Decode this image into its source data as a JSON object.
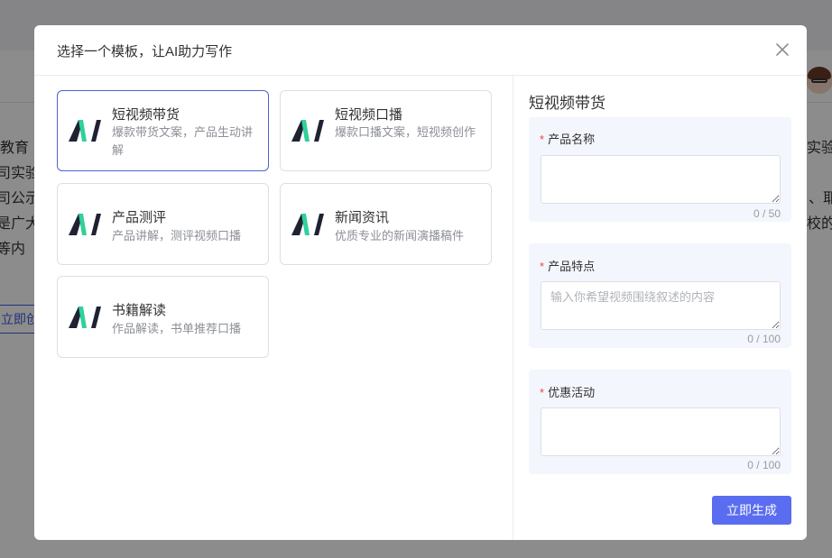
{
  "background": {
    "left_lines": [
      "教育",
      "司实验",
      "司公示",
      "是广大",
      "等内"
    ],
    "right_lines": [
      "实验",
      "、耶",
      "校的"
    ],
    "button_label": "立即创作"
  },
  "dialog": {
    "title": "选择一个模板，让AI助力写作",
    "templates": [
      {
        "name": "短视频带货",
        "desc": "爆款带货文案，产品生动讲解",
        "active": true
      },
      {
        "name": "短视频口播",
        "desc": "爆款口播文案，短视频创作",
        "active": false
      },
      {
        "name": "产品测评",
        "desc": "产品讲解，测评视频口播",
        "active": false
      },
      {
        "name": "新闻资讯",
        "desc": "优质专业的新闻演播稿件",
        "active": false
      },
      {
        "name": "书籍解读",
        "desc": "作品解读，书单推荐口播",
        "active": false
      }
    ],
    "form": {
      "title": "短视频带货",
      "fields": [
        {
          "label": "产品名称",
          "required_mark": "*",
          "value": "",
          "placeholder": "",
          "counter": "0 / 50"
        },
        {
          "label": "产品特点",
          "required_mark": "*",
          "value": "",
          "placeholder": "输入你希望视频围绕叙述的内容",
          "counter": "0 / 100"
        },
        {
          "label": "优惠活动",
          "required_mark": "*",
          "value": "",
          "placeholder": "",
          "counter": "0 / 100"
        }
      ],
      "submit_label": "立即生成"
    }
  },
  "colors": {
    "accent": "#5a6cf0",
    "active_border": "#4c63d2",
    "required": "#e5484d",
    "field_bg": "#f4f6fd",
    "logo_dark": "#1f2233",
    "logo_green": "#2fd19a"
  },
  "icons": {
    "close": "close-icon",
    "template_logo": "ai-logo-icon"
  }
}
